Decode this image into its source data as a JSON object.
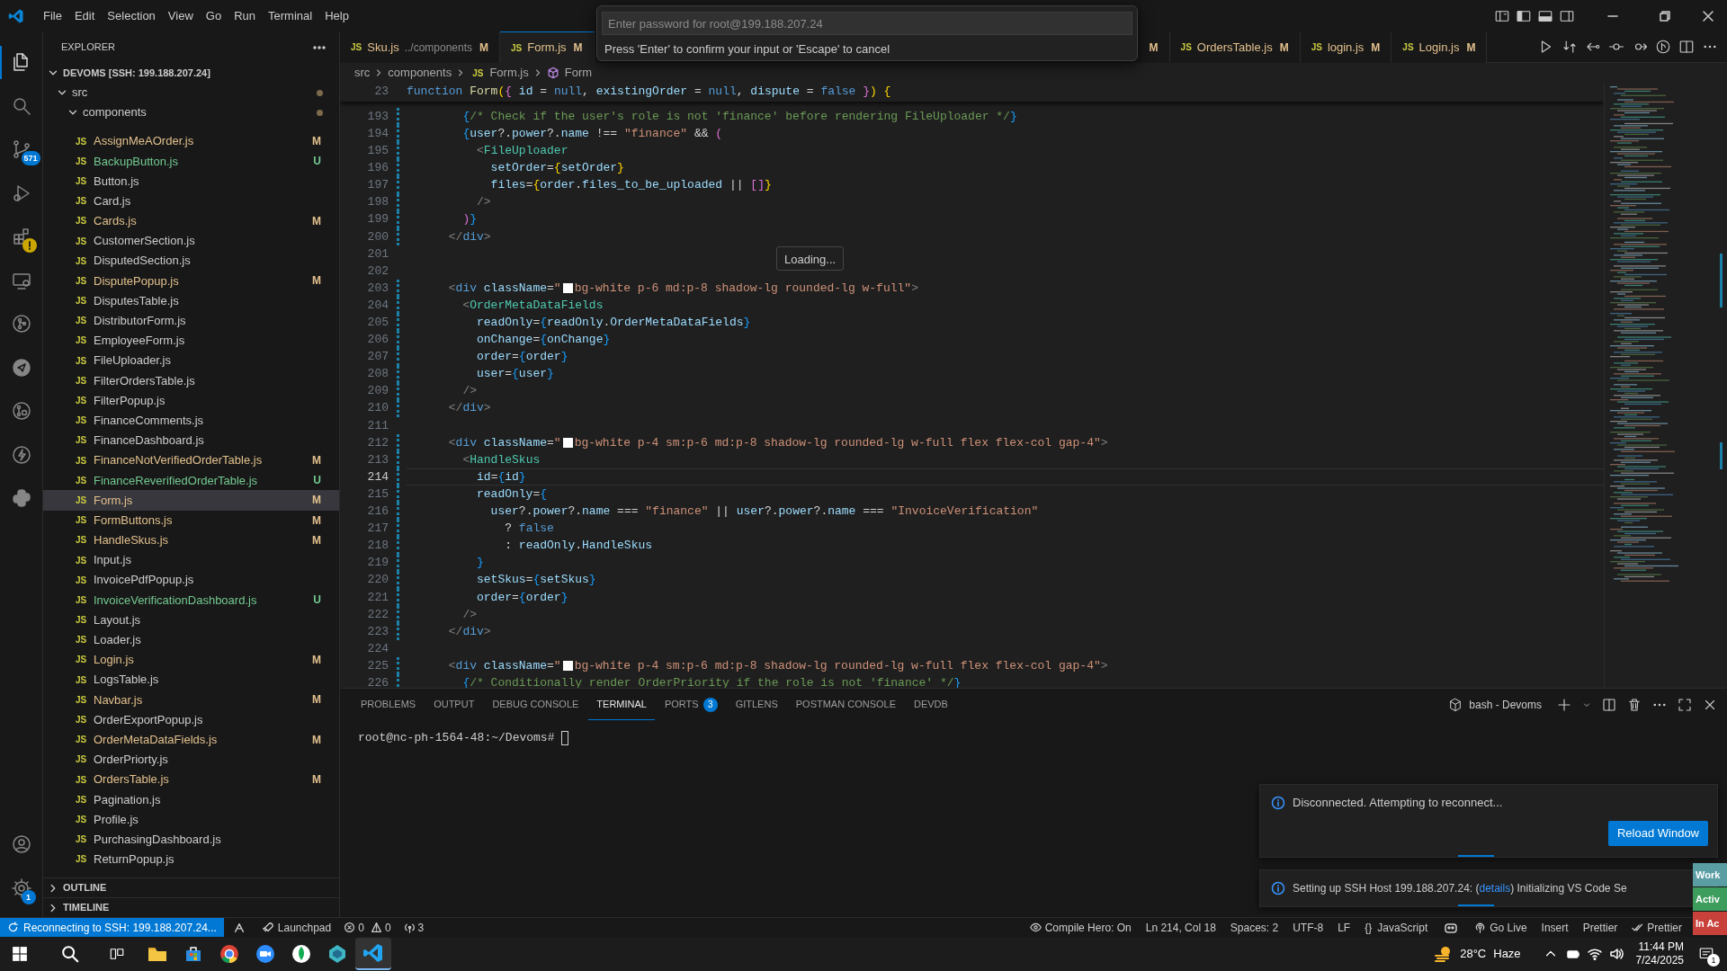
{
  "title_bar": {
    "menu": [
      "File",
      "Edit",
      "Selection",
      "View",
      "Go",
      "Run",
      "Terminal",
      "Help"
    ]
  },
  "quick_input": {
    "placeholder": "Enter password for root@199.188.207.24",
    "message": "Press 'Enter' to confirm your input or 'Escape' to cancel"
  },
  "activity_bar": {
    "top": [
      {
        "selected": true,
        "warning": false
      },
      {
        "selected": false,
        "warning": false
      },
      {
        "selected": false,
        "warning": false,
        "badge": "571"
      },
      {
        "selected": false,
        "warning": false
      },
      {
        "selected": false,
        "warning": true
      },
      {
        "selected": false,
        "warning": false
      },
      {
        "selected": false,
        "warning": false
      },
      {
        "selected": false,
        "warning": false
      },
      {
        "selected": false,
        "warning": false
      },
      {
        "selected": false,
        "warning": false
      },
      {
        "selected": false,
        "warning": false
      }
    ],
    "bottom": [
      {
        "selected": false,
        "warning": false
      },
      {
        "selected": false,
        "warning": false,
        "badge": "1"
      }
    ]
  },
  "sidebar": {
    "title": "EXPLORER",
    "root": {
      "label": "DEVOMS [SSH: 199.188.207.24]",
      "expanded": true,
      "children": [
        {
          "label": "src",
          "expanded": true,
          "modified": true,
          "children": [
            {
              "label": "components",
              "expanded": true,
              "modified": true,
              "children": [
                {
                  "label": "AssignMeAOrder.js",
                  "icon": "JS",
                  "git": "M",
                  "selected": false
                },
                {
                  "label": "BackupButton.js",
                  "icon": "JS",
                  "git": "U",
                  "selected": false
                },
                {
                  "label": "Button.js",
                  "icon": "JS",
                  "selected": false
                },
                {
                  "label": "Card.js",
                  "icon": "JS",
                  "selected": false
                },
                {
                  "label": "Cards.js",
                  "icon": "JS",
                  "git": "M",
                  "selected": false
                },
                {
                  "label": "CustomerSection.js",
                  "icon": "JS",
                  "selected": false
                },
                {
                  "label": "DisputedSection.js",
                  "icon": "JS",
                  "selected": false
                },
                {
                  "label": "DisputePopup.js",
                  "icon": "JS",
                  "git": "M",
                  "selected": false
                },
                {
                  "label": "DisputesTable.js",
                  "icon": "JS",
                  "selected": false
                },
                {
                  "label": "DistributorForm.js",
                  "icon": "JS",
                  "selected": false
                },
                {
                  "label": "EmployeeForm.js",
                  "icon": "JS",
                  "selected": false
                },
                {
                  "label": "FileUploader.js",
                  "icon": "JS",
                  "selected": false
                },
                {
                  "label": "FilterOrdersTable.js",
                  "icon": "JS",
                  "selected": false
                },
                {
                  "label": "FilterPopup.js",
                  "icon": "JS",
                  "selected": false
                },
                {
                  "label": "FinanceComments.js",
                  "icon": "JS",
                  "selected": false
                },
                {
                  "label": "FinanceDashboard.js",
                  "icon": "JS",
                  "selected": false
                },
                {
                  "label": "FinanceNotVerifiedOrderTable.js",
                  "icon": "JS",
                  "git": "M",
                  "selected": false
                },
                {
                  "label": "FinanceReverifiedOrderTable.js",
                  "icon": "JS",
                  "git": "U",
                  "selected": false
                },
                {
                  "label": "Form.js",
                  "icon": "JS",
                  "git": "M",
                  "selected": true
                },
                {
                  "label": "FormButtons.js",
                  "icon": "JS",
                  "git": "M",
                  "selected": false
                },
                {
                  "label": "HandleSkus.js",
                  "icon": "JS",
                  "git": "M",
                  "selected": false
                },
                {
                  "label": "Input.js",
                  "icon": "JS",
                  "selected": false
                },
                {
                  "label": "InvoicePdfPopup.js",
                  "icon": "JS",
                  "selected": false
                },
                {
                  "label": "InvoiceVerificationDashboard.js",
                  "icon": "JS",
                  "git": "U",
                  "selected": false
                },
                {
                  "label": "Layout.js",
                  "icon": "JS",
                  "selected": false
                },
                {
                  "label": "Loader.js",
                  "icon": "JS",
                  "selected": false
                },
                {
                  "label": "Login.js",
                  "icon": "JS",
                  "git": "M",
                  "selected": false
                },
                {
                  "label": "LogsTable.js",
                  "icon": "JS",
                  "selected": false
                },
                {
                  "label": "Navbar.js",
                  "icon": "JS",
                  "git": "M",
                  "selected": false
                },
                {
                  "label": "OrderExportPopup.js",
                  "icon": "JS",
                  "selected": false
                },
                {
                  "label": "OrderMetaDataFields.js",
                  "icon": "JS",
                  "git": "M",
                  "selected": false
                },
                {
                  "label": "OrderPriorty.js",
                  "icon": "JS",
                  "selected": false
                },
                {
                  "label": "OrdersTable.js",
                  "icon": "JS",
                  "git": "M",
                  "selected": false
                },
                {
                  "label": "Pagination.js",
                  "icon": "JS",
                  "selected": false
                },
                {
                  "label": "Profile.js",
                  "icon": "JS",
                  "selected": false
                },
                {
                  "label": "PurchasingDashboard.js",
                  "icon": "JS",
                  "selected": false
                },
                {
                  "label": "ReturnPopup.js",
                  "icon": "JS",
                  "selected": false
                }
              ]
            }
          ]
        }
      ]
    },
    "sections": [
      {
        "label": "OUTLINE",
        "expanded": false
      },
      {
        "label": "TIMELINE",
        "expanded": false
      }
    ]
  },
  "tabs": [
    {
      "label": "Sku.js",
      "icon": "JS",
      "description": "../components",
      "git": "M",
      "selected": false
    },
    {
      "label": "Form.js",
      "icon": "JS",
      "git": "M",
      "selected": true
    },
    {
      "git": "M",
      "selected": false
    },
    {
      "label": "OrdersTable.js",
      "icon": "JS",
      "git": "M",
      "selected": false
    },
    {
      "label": "login.js",
      "icon": "JS",
      "git": "M",
      "selected": false
    },
    {
      "label": "Login.js",
      "icon": "JS",
      "git": "M",
      "selected": false
    }
  ],
  "breadcrumb": [
    {
      "kind": "folder",
      "label": "src"
    },
    {
      "kind": "folder",
      "label": "components"
    },
    {
      "kind": "file",
      "icon": "JS",
      "label": "Form.js"
    },
    {
      "kind": "symbol",
      "label": "Form"
    }
  ],
  "editor": {
    "sticky": {
      "number": "23",
      "tokens": [
        {
          "kind": "keyword",
          "text": "function "
        },
        {
          "kind": "function",
          "text": "Form"
        },
        {
          "kind": "bracket1",
          "text": "("
        },
        {
          "kind": "bracket2",
          "text": "{"
        },
        {
          "kind": "variable",
          "text": " id"
        },
        {
          "kind": "plain",
          "text": " = "
        },
        {
          "kind": "keyword",
          "text": "null"
        },
        {
          "kind": "plain",
          "text": ", "
        },
        {
          "kind": "variable",
          "text": "existingOrder"
        },
        {
          "kind": "plain",
          "text": " = "
        },
        {
          "kind": "keyword",
          "text": "null"
        },
        {
          "kind": "plain",
          "text": ", "
        },
        {
          "kind": "variable",
          "text": "dispute"
        },
        {
          "kind": "plain",
          "text": " = "
        },
        {
          "kind": "keyword",
          "text": "false"
        },
        {
          "kind": "bracket2",
          "text": " }"
        },
        {
          "kind": "bracket1",
          "text": ")"
        },
        {
          "kind": "bracket1",
          "text": " {"
        }
      ]
    },
    "lines": [
      {
        "number": "193",
        "current": false,
        "changed": true,
        "tokens": [
          {
            "kind": "bracket3",
            "text": "        {"
          },
          {
            "kind": "comment",
            "text": "/* Check if the user's role is not 'finance' before rendering FileUploader */"
          },
          {
            "kind": "bracket3",
            "text": "}"
          }
        ]
      },
      {
        "number": "194",
        "current": false,
        "changed": true,
        "tokens": [
          {
            "kind": "bracket3",
            "text": "        {"
          },
          {
            "kind": "variable",
            "text": "user"
          },
          {
            "kind": "plain",
            "text": "?."
          },
          {
            "kind": "variable",
            "text": "power"
          },
          {
            "kind": "plain",
            "text": "?."
          },
          {
            "kind": "variable",
            "text": "name"
          },
          {
            "kind": "plain",
            "text": " !== "
          },
          {
            "kind": "string",
            "text": "\"finance\""
          },
          {
            "kind": "plain",
            "text": " && "
          },
          {
            "kind": "bracket2",
            "text": "("
          }
        ]
      },
      {
        "number": "195",
        "current": false,
        "changed": true,
        "tokens": [
          {
            "kind": "angle",
            "text": "          <"
          },
          {
            "kind": "component",
            "text": "FileUploader"
          }
        ]
      },
      {
        "number": "196",
        "current": false,
        "changed": true,
        "tokens": [
          {
            "kind": "variable",
            "text": "            setOrder"
          },
          {
            "kind": "plain",
            "text": "="
          },
          {
            "kind": "bracket1",
            "text": "{"
          },
          {
            "kind": "variable",
            "text": "setOrder"
          },
          {
            "kind": "bracket1",
            "text": "}"
          }
        ]
      },
      {
        "number": "197",
        "current": false,
        "changed": true,
        "tokens": [
          {
            "kind": "variable",
            "text": "            files"
          },
          {
            "kind": "plain",
            "text": "="
          },
          {
            "kind": "bracket1",
            "text": "{"
          },
          {
            "kind": "variable",
            "text": "order"
          },
          {
            "kind": "plain",
            "text": "."
          },
          {
            "kind": "variable",
            "text": "files_to_be_uploaded"
          },
          {
            "kind": "plain",
            "text": " || "
          },
          {
            "kind": "bracket2",
            "text": "[]"
          },
          {
            "kind": "bracket1",
            "text": "}"
          }
        ]
      },
      {
        "number": "198",
        "current": false,
        "changed": true,
        "tokens": [
          {
            "kind": "angle",
            "text": "          />"
          }
        ]
      },
      {
        "number": "199",
        "current": false,
        "changed": true,
        "tokens": [
          {
            "kind": "bracket2",
            "text": "        )"
          },
          {
            "kind": "bracket3",
            "text": "}"
          }
        ]
      },
      {
        "number": "200",
        "current": false,
        "changed": true,
        "tokens": [
          {
            "kind": "angle",
            "text": "      </"
          },
          {
            "kind": "keyword",
            "text": "div"
          },
          {
            "kind": "angle",
            "text": ">"
          }
        ]
      },
      {
        "number": "201",
        "current": false,
        "changed": false
      },
      {
        "number": "202",
        "current": false,
        "changed": false
      },
      {
        "number": "203",
        "current": false,
        "changed": true,
        "tokens": [
          {
            "kind": "angle",
            "text": "      <"
          },
          {
            "kind": "keyword",
            "text": "div"
          },
          {
            "kind": "variable",
            "text": " className"
          },
          {
            "kind": "plain",
            "text": "="
          },
          {
            "kind": "string",
            "text": "\""
          },
          {
            "kind": "swatch",
            "color": "#ffffff"
          },
          {
            "kind": "string",
            "text": "bg-white p-6 md:p-8 shadow-lg rounded-lg w-full\""
          },
          {
            "kind": "angle",
            "text": ">"
          }
        ]
      },
      {
        "number": "204",
        "current": false,
        "changed": true,
        "tokens": [
          {
            "kind": "angle",
            "text": "        <"
          },
          {
            "kind": "component",
            "text": "OrderMetaDataFields"
          }
        ]
      },
      {
        "number": "205",
        "current": false,
        "changed": true,
        "tokens": [
          {
            "kind": "variable",
            "text": "          readOnly"
          },
          {
            "kind": "plain",
            "text": "="
          },
          {
            "kind": "bracket3",
            "text": "{"
          },
          {
            "kind": "variable",
            "text": "readOnly"
          },
          {
            "kind": "plain",
            "text": "."
          },
          {
            "kind": "variable",
            "text": "OrderMetaDataFields"
          },
          {
            "kind": "bracket3",
            "text": "}"
          }
        ]
      },
      {
        "number": "206",
        "current": false,
        "changed": true,
        "tokens": [
          {
            "kind": "variable",
            "text": "          onChange"
          },
          {
            "kind": "plain",
            "text": "="
          },
          {
            "kind": "bracket3",
            "text": "{"
          },
          {
            "kind": "variable",
            "text": "onChange"
          },
          {
            "kind": "bracket3",
            "text": "}"
          }
        ]
      },
      {
        "number": "207",
        "current": false,
        "changed": true,
        "tokens": [
          {
            "kind": "variable",
            "text": "          order"
          },
          {
            "kind": "plain",
            "text": "="
          },
          {
            "kind": "bracket3",
            "text": "{"
          },
          {
            "kind": "variable",
            "text": "order"
          },
          {
            "kind": "bracket3",
            "text": "}"
          }
        ]
      },
      {
        "number": "208",
        "current": false,
        "changed": true,
        "tokens": [
          {
            "kind": "variable",
            "text": "          user"
          },
          {
            "kind": "plain",
            "text": "="
          },
          {
            "kind": "bracket3",
            "text": "{"
          },
          {
            "kind": "variable",
            "text": "user"
          },
          {
            "kind": "bracket3",
            "text": "}"
          }
        ]
      },
      {
        "number": "209",
        "current": false,
        "changed": true,
        "tokens": [
          {
            "kind": "angle",
            "text": "        />"
          }
        ]
      },
      {
        "number": "210",
        "current": false,
        "changed": true,
        "tokens": [
          {
            "kind": "angle",
            "text": "      </"
          },
          {
            "kind": "keyword",
            "text": "div"
          },
          {
            "kind": "angle",
            "text": ">"
          }
        ]
      },
      {
        "number": "211",
        "current": false,
        "changed": false
      },
      {
        "number": "212",
        "current": false,
        "changed": true,
        "tokens": [
          {
            "kind": "angle",
            "text": "      <"
          },
          {
            "kind": "keyword",
            "text": "div"
          },
          {
            "kind": "variable",
            "text": " className"
          },
          {
            "kind": "plain",
            "text": "="
          },
          {
            "kind": "string",
            "text": "\""
          },
          {
            "kind": "swatch",
            "color": "#ffffff"
          },
          {
            "kind": "string",
            "text": "bg-white p-4 sm:p-6 md:p-8 shadow-lg rounded-lg w-full flex flex-col gap-4\""
          },
          {
            "kind": "angle",
            "text": ">"
          }
        ]
      },
      {
        "number": "213",
        "current": false,
        "changed": true,
        "tokens": [
          {
            "kind": "angle",
            "text": "        <"
          },
          {
            "kind": "component",
            "text": "HandleSkus"
          }
        ]
      },
      {
        "number": "214",
        "current": true,
        "changed": true,
        "tokens": [
          {
            "kind": "variable",
            "text": "          id"
          },
          {
            "kind": "plain",
            "text": "="
          },
          {
            "kind": "bracket3",
            "text": "{"
          },
          {
            "kind": "variable",
            "text": "id"
          },
          {
            "kind": "bracket3",
            "text": "}"
          }
        ]
      },
      {
        "number": "215",
        "current": false,
        "changed": true,
        "tokens": [
          {
            "kind": "variable",
            "text": "          readOnly"
          },
          {
            "kind": "plain",
            "text": "="
          },
          {
            "kind": "bracket3",
            "text": "{"
          }
        ]
      },
      {
        "number": "216",
        "current": false,
        "changed": true,
        "tokens": [
          {
            "kind": "variable",
            "text": "            user"
          },
          {
            "kind": "plain",
            "text": "?."
          },
          {
            "kind": "variable",
            "text": "power"
          },
          {
            "kind": "plain",
            "text": "?."
          },
          {
            "kind": "variable",
            "text": "name"
          },
          {
            "kind": "plain",
            "text": " === "
          },
          {
            "kind": "string",
            "text": "\"finance\""
          },
          {
            "kind": "plain",
            "text": " || "
          },
          {
            "kind": "variable",
            "text": "user"
          },
          {
            "kind": "plain",
            "text": "?."
          },
          {
            "kind": "variable",
            "text": "power"
          },
          {
            "kind": "plain",
            "text": "?."
          },
          {
            "kind": "variable",
            "text": "name"
          },
          {
            "kind": "plain",
            "text": " === "
          },
          {
            "kind": "string",
            "text": "\"InvoiceVerification\""
          }
        ]
      },
      {
        "number": "217",
        "current": false,
        "changed": true,
        "tokens": [
          {
            "kind": "plain",
            "text": "              ? "
          },
          {
            "kind": "keyword",
            "text": "false"
          }
        ]
      },
      {
        "number": "218",
        "current": false,
        "changed": true,
        "tokens": [
          {
            "kind": "plain",
            "text": "              : "
          },
          {
            "kind": "variable",
            "text": "readOnly"
          },
          {
            "kind": "plain",
            "text": "."
          },
          {
            "kind": "variable",
            "text": "HandleSkus"
          }
        ]
      },
      {
        "number": "219",
        "current": false,
        "changed": true,
        "tokens": [
          {
            "kind": "bracket3",
            "text": "          }"
          }
        ]
      },
      {
        "number": "220",
        "current": false,
        "changed": true,
        "tokens": [
          {
            "kind": "variable",
            "text": "          setSkus"
          },
          {
            "kind": "plain",
            "text": "="
          },
          {
            "kind": "bracket3",
            "text": "{"
          },
          {
            "kind": "variable",
            "text": "setSkus"
          },
          {
            "kind": "bracket3",
            "text": "}"
          }
        ]
      },
      {
        "number": "221",
        "current": false,
        "changed": true,
        "tokens": [
          {
            "kind": "variable",
            "text": "          order"
          },
          {
            "kind": "plain",
            "text": "="
          },
          {
            "kind": "bracket3",
            "text": "{"
          },
          {
            "kind": "variable",
            "text": "order"
          },
          {
            "kind": "bracket3",
            "text": "}"
          }
        ]
      },
      {
        "number": "222",
        "current": false,
        "changed": true,
        "tokens": [
          {
            "kind": "angle",
            "text": "        />"
          }
        ]
      },
      {
        "number": "223",
        "current": false,
        "changed": true,
        "tokens": [
          {
            "kind": "angle",
            "text": "      </"
          },
          {
            "kind": "keyword",
            "text": "div"
          },
          {
            "kind": "angle",
            "text": ">"
          }
        ]
      },
      {
        "number": "224",
        "current": false,
        "changed": false
      },
      {
        "number": "225",
        "current": false,
        "changed": true,
        "tokens": [
          {
            "kind": "angle",
            "text": "      <"
          },
          {
            "kind": "keyword",
            "text": "div"
          },
          {
            "kind": "variable",
            "text": " className"
          },
          {
            "kind": "plain",
            "text": "="
          },
          {
            "kind": "string",
            "text": "\""
          },
          {
            "kind": "swatch",
            "color": "#ffffff"
          },
          {
            "kind": "string",
            "text": "bg-white p-4 sm:p-6 md:p-8 shadow-lg rounded-lg w-full flex flex-col gap-4\""
          },
          {
            "kind": "angle",
            "text": ">"
          }
        ]
      },
      {
        "number": "226",
        "current": false,
        "changed": true,
        "tokens": [
          {
            "kind": "bracket3",
            "text": "        {"
          },
          {
            "kind": "comment",
            "text": "/* Conditionally render OrderPriority if the role is not 'finance' */"
          },
          {
            "kind": "bracket3",
            "text": "}"
          }
        ]
      }
    ],
    "hover": "Loading..."
  },
  "panel": {
    "tabs": [
      {
        "label": "PROBLEMS",
        "selected": false
      },
      {
        "label": "OUTPUT",
        "selected": false
      },
      {
        "label": "DEBUG CONSOLE",
        "selected": false
      },
      {
        "label": "TERMINAL",
        "selected": true
      },
      {
        "label": "PORTS",
        "badge": "3",
        "selected": false
      },
      {
        "label": "GITLENS",
        "selected": false
      },
      {
        "label": "POSTMAN CONSOLE",
        "selected": false
      },
      {
        "label": "DEVDB",
        "selected": false
      }
    ],
    "terminal_name": "bash - Devoms",
    "prompt": "root@nc-ph-1564-48:~/Devoms#"
  },
  "notifications": [
    {
      "kind": "action",
      "message": "Disconnected. Attempting to reconnect...",
      "button": "Reload Window"
    },
    {
      "kind": "progress",
      "before": "Setting up SSH Host 199.188.207.24: (",
      "link": "details",
      "after": ") Initializing VS Code Se"
    }
  ],
  "side_widgets": [
    {
      "label": "Work",
      "color": "#5a9ea4"
    },
    {
      "label": "Activ",
      "color": "#3c9d5d"
    },
    {
      "label": "In Ac",
      "color": "#c8423b"
    }
  ],
  "status_bar": {
    "remote": "Reconnecting to SSH: 199.188.207.24...",
    "launchpad": "Launchpad",
    "errors": "0",
    "warnings": "0",
    "ports": "3",
    "right": [
      {
        "kind": "eye",
        "label": "Compile Hero: On"
      },
      {
        "kind": "text",
        "label": "Ln 214, Col 18"
      },
      {
        "kind": "text",
        "label": "Spaces: 2"
      },
      {
        "kind": "text",
        "label": "UTF-8"
      },
      {
        "kind": "text",
        "label": "LF"
      },
      {
        "kind": "glyph",
        "glyph": "{}",
        "label": "JavaScript"
      },
      {
        "kind": "copilot"
      },
      {
        "kind": "broadcast",
        "label": "Go Live"
      },
      {
        "kind": "text",
        "label": "Insert"
      },
      {
        "kind": "text",
        "label": "Prettier"
      },
      {
        "kind": "checks",
        "label": "Prettier"
      }
    ]
  },
  "taskbar": {
    "apps": [
      {
        "selected": false
      },
      {
        "selected": false
      },
      {
        "selected": false
      },
      {
        "selected": false
      },
      {
        "selected": false
      },
      {
        "selected": true
      }
    ],
    "temperature": "28°C",
    "weather": "Haze",
    "time": "11:44 PM",
    "date": "7/24/2025",
    "notification_count": "1"
  }
}
